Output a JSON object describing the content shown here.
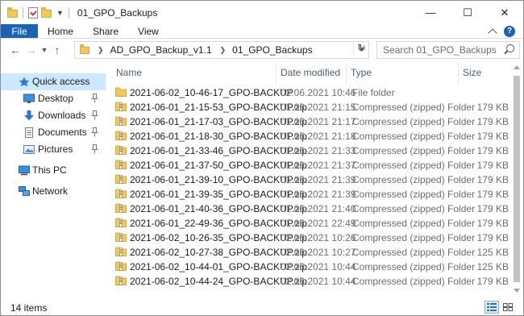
{
  "window": {
    "title": "01_GPO_Backups",
    "controls": {
      "minimize": "—",
      "maximize": "☐",
      "close": "✕"
    }
  },
  "ribbon": {
    "file": "File",
    "tabs": [
      "Home",
      "Share",
      "View"
    ]
  },
  "address": {
    "crumbs": [
      "AD_GPO_Backup_v1.1",
      "01_GPO_Backups"
    ],
    "search_placeholder": "Search 01_GPO_Backups"
  },
  "sidebar": {
    "items": [
      {
        "label": "Quick access",
        "icon": "star-icon",
        "selected": true,
        "pinned": false
      },
      {
        "label": "Desktop",
        "icon": "desktop-icon",
        "selected": false,
        "pinned": true
      },
      {
        "label": "Downloads",
        "icon": "downloads-icon",
        "selected": false,
        "pinned": true
      },
      {
        "label": "Documents",
        "icon": "documents-icon",
        "selected": false,
        "pinned": true
      },
      {
        "label": "Pictures",
        "icon": "pictures-icon",
        "selected": false,
        "pinned": true
      },
      {
        "label": "This PC",
        "icon": "pc-icon",
        "selected": false,
        "pinned": false
      },
      {
        "label": "Network",
        "icon": "network-icon",
        "selected": false,
        "pinned": false
      }
    ]
  },
  "columns": {
    "name": "Name",
    "date": "Date modified",
    "type": "Type",
    "size": "Size"
  },
  "files": [
    {
      "name": "2021-06-02_10-46-17_GPO-BACKUP",
      "date": "02.06.2021 10:46",
      "type": "File folder",
      "size": "",
      "kind": "folder"
    },
    {
      "name": "2021-06-01_21-15-53_GPO-BACKUP.zip",
      "date": "01.06.2021 21:15",
      "type": "Compressed (zipped) Folder",
      "size": "179 KB",
      "kind": "zip"
    },
    {
      "name": "2021-06-01_21-17-03_GPO-BACKUP.zip",
      "date": "01.06.2021 21:17",
      "type": "Compressed (zipped) Folder",
      "size": "179 KB",
      "kind": "zip"
    },
    {
      "name": "2021-06-01_21-18-30_GPO-BACKUP.zip",
      "date": "01.06.2021 21:18",
      "type": "Compressed (zipped) Folder",
      "size": "179 KB",
      "kind": "zip"
    },
    {
      "name": "2021-06-01_21-33-46_GPO-BACKUP.zip",
      "date": "01.06.2021 21:33",
      "type": "Compressed (zipped) Folder",
      "size": "179 KB",
      "kind": "zip"
    },
    {
      "name": "2021-06-01_21-37-50_GPO-BACKUP.zip",
      "date": "01.06.2021 21:37",
      "type": "Compressed (zipped) Folder",
      "size": "179 KB",
      "kind": "zip"
    },
    {
      "name": "2021-06-01_21-39-10_GPO-BACKUP.zip",
      "date": "01.06.2021 21:39",
      "type": "Compressed (zipped) Folder",
      "size": "179 KB",
      "kind": "zip"
    },
    {
      "name": "2021-06-01_21-39-35_GPO-BACKUP.zip",
      "date": "01.06.2021 21:39",
      "type": "Compressed (zipped) Folder",
      "size": "179 KB",
      "kind": "zip"
    },
    {
      "name": "2021-06-01_21-40-36_GPO-BACKUP.zip",
      "date": "01.06.2021 21:40",
      "type": "Compressed (zipped) Folder",
      "size": "179 KB",
      "kind": "zip"
    },
    {
      "name": "2021-06-01_22-49-36_GPO-BACKUP.zip",
      "date": "01.06.2021 22:49",
      "type": "Compressed (zipped) Folder",
      "size": "179 KB",
      "kind": "zip"
    },
    {
      "name": "2021-06-02_10-26-35_GPO-BACKUP.zip",
      "date": "02.06.2021 10:26",
      "type": "Compressed (zipped) Folder",
      "size": "179 KB",
      "kind": "zip"
    },
    {
      "name": "2021-06-02_10-27-38_GPO-BACKUP.zip",
      "date": "02.06.2021 10:27",
      "type": "Compressed (zipped) Folder",
      "size": "125 KB",
      "kind": "zip"
    },
    {
      "name": "2021-06-02_10-44-01_GPO-BACKUP.zip",
      "date": "02.06.2021 10:44",
      "type": "Compressed (zipped) Folder",
      "size": "125 KB",
      "kind": "zip"
    },
    {
      "name": "2021-06-02_10-44-24_GPO-BACKUP.zip",
      "date": "02.06.2021 10:44",
      "type": "Compressed (zipped) Folder",
      "size": "179 KB",
      "kind": "zip"
    }
  ],
  "status": {
    "count": "14 items"
  },
  "colors": {
    "accent": "#1a63b5",
    "selected": "#cce8ff",
    "header_text": "#4c607a",
    "folder": "#f2c75c"
  }
}
